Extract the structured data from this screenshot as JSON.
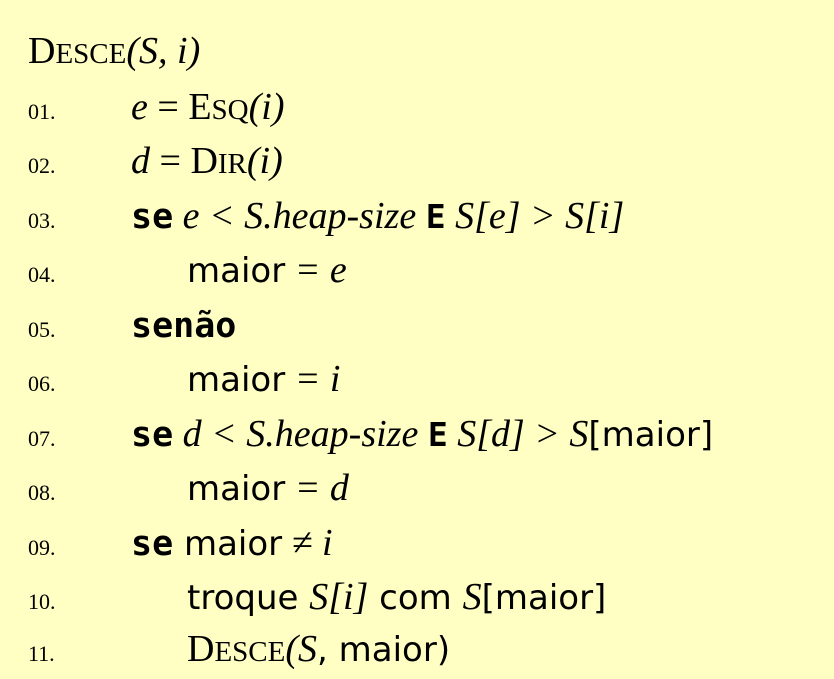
{
  "title": {
    "name_first": "D",
    "name_rest": "ESCE",
    "args": "(S, i)"
  },
  "lines": [
    {
      "num": "01.",
      "lhs": "e",
      "eq": " = ",
      "fn_first": "E",
      "fn_rest": "SQ",
      "arg": "(i)"
    },
    {
      "num": "02.",
      "lhs": "d",
      "eq": " = ",
      "fn_first": "D",
      "fn_rest": "IR",
      "arg": "(i)"
    },
    {
      "num": "03.",
      "kw": "se",
      "cond1": " e < S.heap-size ",
      "and": "E",
      "cond2_a": " S[e] > S[i]"
    },
    {
      "num": "04.",
      "var": "maior",
      "rest": "  = e"
    },
    {
      "num": "05.",
      "kw": "senão"
    },
    {
      "num": "06.",
      "var": "maior",
      "rest": "  = i"
    },
    {
      "num": "07.",
      "kw": "se",
      "cond1": " d < S.heap-size ",
      "and": "E",
      "cond2_a": " S[d] > S",
      "cond2_b": "[maior]"
    },
    {
      "num": "08.",
      "var": "maior",
      "rest": "  = d"
    },
    {
      "num": "09.",
      "kw": "se",
      "var": " maior",
      "rest": "  ≠ i"
    },
    {
      "num": "10.",
      "t1": "troque ",
      "t2": "S[i]",
      "t3": " com ",
      "t4": "S",
      "t5": "[maior]"
    },
    {
      "num": "11.",
      "fn_first": "D",
      "fn_rest": "ESCE",
      "t2": "(S",
      "t3": ", maior)"
    }
  ]
}
